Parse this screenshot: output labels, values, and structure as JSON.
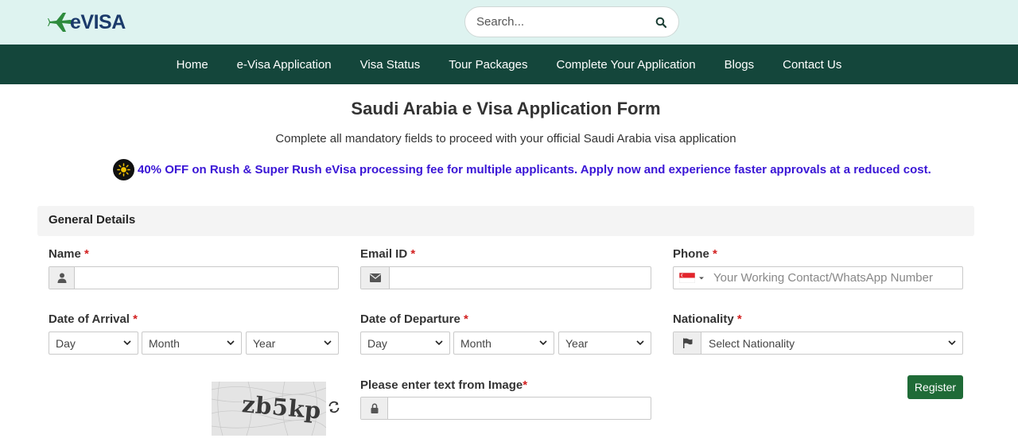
{
  "header": {
    "logo_text": "eVISA",
    "search": {
      "placeholder": "Search..."
    }
  },
  "nav": {
    "items": [
      {
        "label": "Home"
      },
      {
        "label": "e-Visa Application"
      },
      {
        "label": "Visa Status"
      },
      {
        "label": "Tour Packages"
      },
      {
        "label": "Complete Your Application"
      },
      {
        "label": "Blogs"
      },
      {
        "label": "Contact Us"
      }
    ]
  },
  "page": {
    "title": "Saudi Arabia e Visa Application Form",
    "subtitle": "Complete all mandatory fields to proceed with your official Saudi Arabia visa application",
    "promo": "40% OFF on Rush & Super Rush eVisa processing fee for multiple applicants. Apply now and experience faster approvals at a reduced cost."
  },
  "form": {
    "section_title": "General Details",
    "required_mark": "*",
    "name": {
      "label": "Name",
      "value": ""
    },
    "email": {
      "label": "Email ID",
      "value": ""
    },
    "phone": {
      "label": "Phone",
      "placeholder": "Your Working Contact/WhatsApp Number"
    },
    "arrival": {
      "label": "Date of Arrival",
      "day": "Day",
      "month": "Month",
      "year": "Year"
    },
    "departure": {
      "label": "Date of Departure",
      "day": "Day",
      "month": "Month",
      "year": "Year"
    },
    "nationality": {
      "label": "Nationality",
      "selected": "Select Nationality"
    },
    "captcha": {
      "label": "Please enter text from Image",
      "image_text": "zb5kp",
      "value": ""
    },
    "register_label": "Register"
  },
  "colors": {
    "topbar_bg": "#def3f0",
    "nav_bg": "#14463b",
    "promo_text": "#3a16d6",
    "required": "#d21f1f",
    "register_bg": "#1f6b37"
  }
}
